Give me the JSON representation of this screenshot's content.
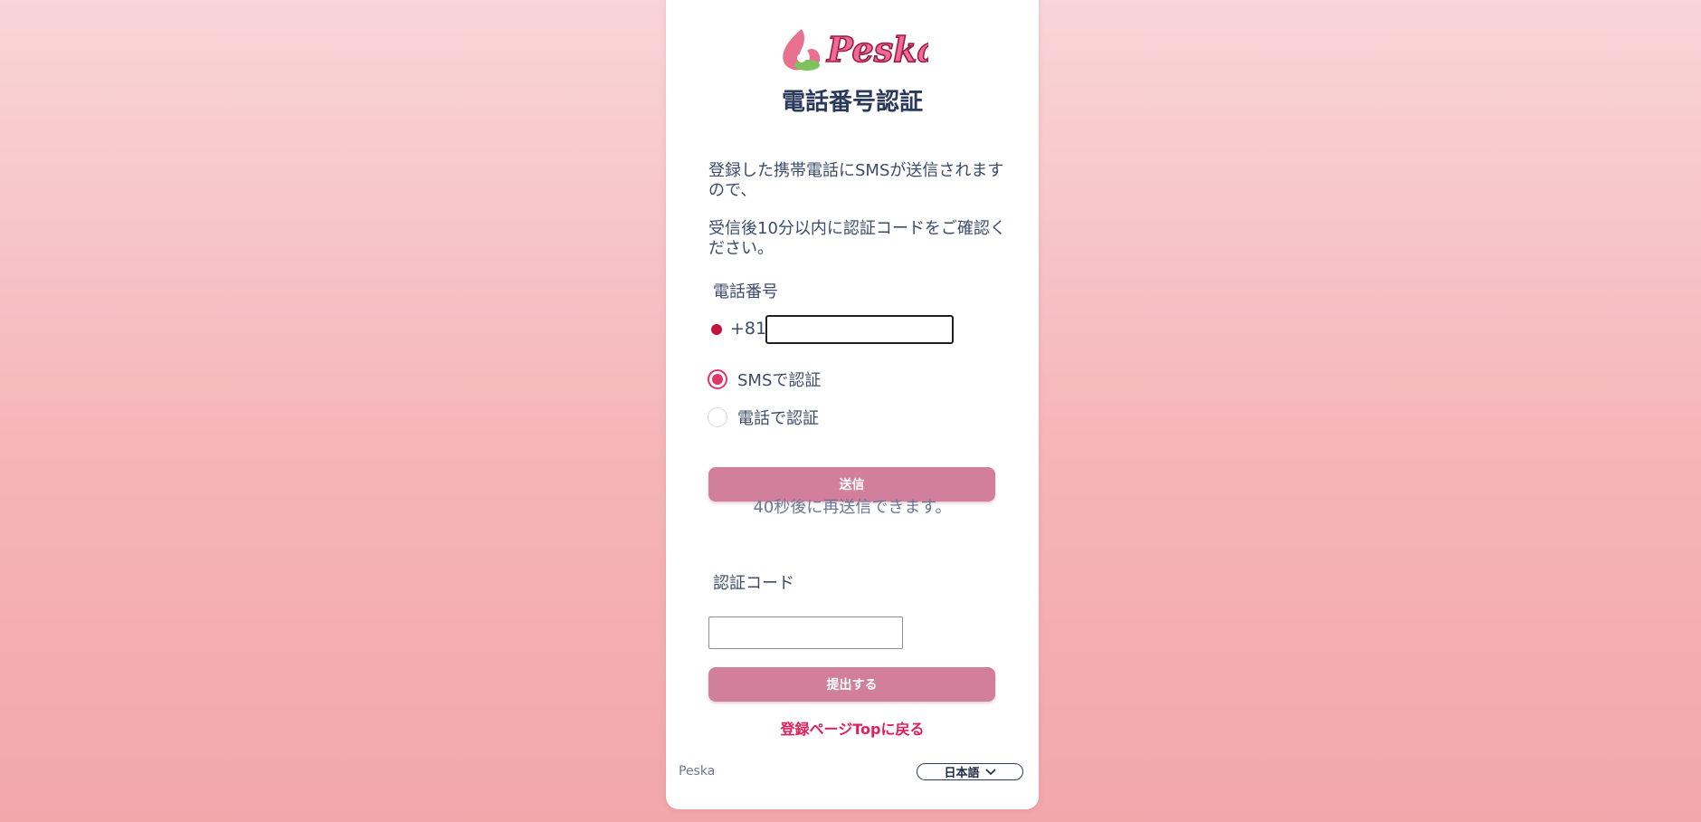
{
  "brand": {
    "logo_text": "Peska",
    "primary_color": "#d27f9b",
    "link_color": "#e01e5a"
  },
  "page": {
    "title": "電話番号認証",
    "intro_line1": "登録した携帯電話にSMSが送信されますので、",
    "intro_line2": "受信後10分以内に認証コードをご確認ください。"
  },
  "phone": {
    "label": "電話番号",
    "country_code": "+81",
    "value": ""
  },
  "method": {
    "options": [
      {
        "label": "SMSで認証",
        "checked": true
      },
      {
        "label": "電話で認証",
        "checked": false
      }
    ]
  },
  "send": {
    "button_label": "送信",
    "resend_note": "40秒後に再送信できます。"
  },
  "code": {
    "label": "認証コード",
    "value": ""
  },
  "submit": {
    "button_label": "提出する"
  },
  "back_link": "登録ページTopに戻る",
  "footer": {
    "brand": "Peska",
    "language": "日本語"
  }
}
